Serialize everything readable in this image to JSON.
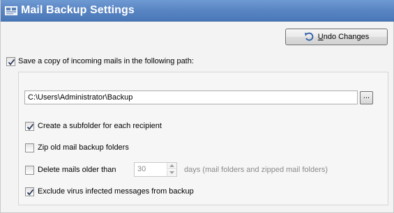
{
  "window": {
    "title": "Mail Backup Settings",
    "icon": "mail-backup-icon"
  },
  "toolbar": {
    "undo_label_underlined": "U",
    "undo_label_rest": "ndo Changes",
    "undo_icon": "undo-arrow-icon"
  },
  "save_copy": {
    "label": "Save a copy of incoming mails in the following path:",
    "checked": true
  },
  "path": {
    "value": "C:\\Users\\Administrator\\Backup",
    "browse_label": "..."
  },
  "options": {
    "subfolder": {
      "label": "Create a subfolder for each recipient",
      "checked": true
    },
    "zip": {
      "label": "Zip old mail backup folders",
      "checked": false
    },
    "delete": {
      "label": "Delete mails older than",
      "checked": false,
      "days_value": "30",
      "days_suffix": "days (mail folders and zipped mail folders)"
    },
    "exclude_virus": {
      "label": "Exclude virus infected messages from backup",
      "checked": true
    }
  },
  "colors": {
    "title_bar": "#5a86c4",
    "check_mark": "#2b3a5a",
    "disabled_text": "#8a8a8a"
  }
}
